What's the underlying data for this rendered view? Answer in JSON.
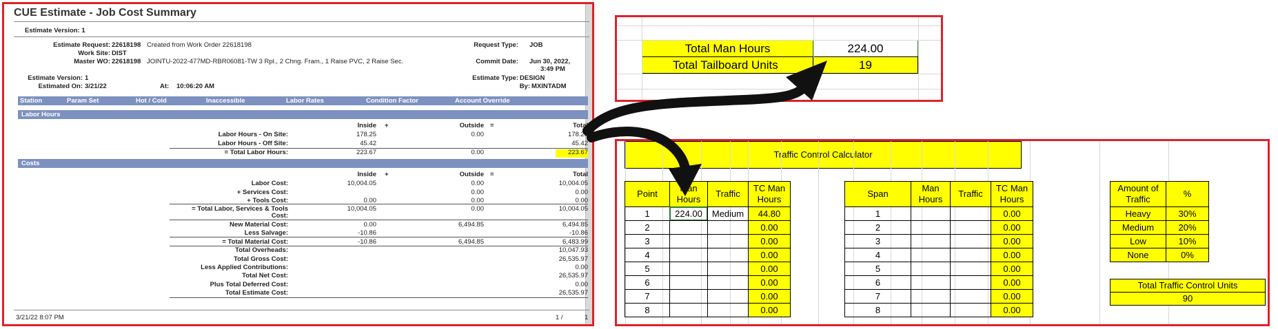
{
  "report": {
    "title": "CUE Estimate - Job Cost Summary",
    "version_line": "Estimate Version: 1",
    "estimate_request_label": "Estimate Request:",
    "estimate_request_value": "22618198",
    "created_from": "Created from Work Order 22618198",
    "request_type_label": "Request Type:",
    "request_type_value": "JOB",
    "work_site_label": "Work Site:",
    "work_site_value": "DIST",
    "master_wo_label": "Master WO:",
    "master_wo_value": "22618198",
    "master_wo_desc": "JOINTU-2022-477MD-RBR06081-TW 3 Rpl., 2 Chng. Fram., 1 Raise PVC, 2 Raise Sec.",
    "commit_date_label": "Commit Date:",
    "commit_date_value": "Jun 30, 2022,",
    "commit_time_value": "3:49 PM",
    "estimate_version_label": "Estimate Version:",
    "estimate_version_value": "1",
    "estimate_type_label": "Estimate Type:",
    "estimate_type_value": "DESIGN",
    "estimated_on_label": "Estimated On:",
    "estimated_on_value": "3/21/22",
    "at_label": "At:",
    "at_value": "10:06:20 AM",
    "by_label": "By:",
    "by_value": "MXINTADM",
    "station_columns": [
      "Station",
      "Param Set",
      "Hot / Cold",
      "Inaccessible",
      "Labor Rates",
      "Condition  Factor",
      "Account Override"
    ],
    "labor_section": "Labor Hours",
    "costs_section": "Costs",
    "col_headers": {
      "inside": "Inside",
      "plus": "+",
      "outside": "Outside",
      "eq": "=",
      "total": "Total"
    },
    "labor_rows": [
      {
        "label": "Labor Hours - On Site:",
        "inside": "178.25",
        "outside": "0.00",
        "total": "178.25"
      },
      {
        "label": "Labor Hours - Off Site:",
        "inside": "45.42",
        "outside": "",
        "total": "45.42"
      },
      {
        "label": "= Total Labor Hours:",
        "inside": "223.67",
        "outside": "0.00",
        "total": "223.67"
      }
    ],
    "cost_rows": [
      {
        "label": "Labor Cost:",
        "inside": "10,004.05",
        "outside": "0.00",
        "total": "10,004.05"
      },
      {
        "label": "+ Services Cost:",
        "inside": "",
        "outside": "0.00",
        "total": "0.00"
      },
      {
        "label": "+ Tools Cost:",
        "inside": "0.00",
        "outside": "0.00",
        "total": "0.00"
      },
      {
        "label": "= Total Labor, Services & Tools",
        "label2": "Cost:",
        "inside": "10,004.05",
        "outside": "0.00",
        "total": "10,004.05"
      },
      {
        "label": "New Material Cost:",
        "inside": "0.00",
        "outside": "6,494.85",
        "total": "6,494.85"
      },
      {
        "label": "Less Salvage:",
        "inside": "-10.86",
        "outside": "",
        "total": "-10.86"
      },
      {
        "label": "= Total Material Cost:",
        "inside": "-10.86",
        "outside": "6,494.85",
        "total": "6,483.99"
      },
      {
        "label": "Total Overheads:",
        "inside": "",
        "outside": "",
        "total": "10,047.93"
      },
      {
        "label": "Total Gross Cost:",
        "inside": "",
        "outside": "",
        "total": "26,535.97"
      },
      {
        "label": "Less Applied Contributions:",
        "inside": "",
        "outside": "",
        "total": "0.00"
      },
      {
        "label": "Total Net Cost:",
        "inside": "",
        "outside": "",
        "total": "26,535.97"
      },
      {
        "label": "Plus Total Deferred Cost:",
        "inside": "",
        "outside": "",
        "total": "0.00"
      },
      {
        "label": "Total Estimate Cost:",
        "inside": "",
        "outside": "",
        "total": "26,535.97"
      }
    ],
    "footer_datetime": "3/21/22 8:07 PM",
    "footer_page": "1 /",
    "footer_pages": "1"
  },
  "summary": {
    "total_man_hours_label": "Total Man Hours",
    "total_man_hours_value": "224.00",
    "total_tailboard_label": "Total Tailboard Units",
    "total_tailboard_value": "19"
  },
  "calculator": {
    "title": "Traffic Control Calculator",
    "point_headers": {
      "point": "Point",
      "man_hours": "Man\nHours",
      "traffic": "Traffic",
      "tc_man_hours": "TC Man\nHours"
    },
    "span_headers": {
      "span": "Span",
      "man_hours": "Man\nHours",
      "traffic": "Traffic",
      "tc_man_hours": "TC Man\nHours"
    },
    "point_rows": [
      {
        "n": "1",
        "mh": "224.00",
        "traffic": "Medium",
        "tc": "44.80"
      },
      {
        "n": "2",
        "mh": "",
        "traffic": "",
        "tc": "0.00"
      },
      {
        "n": "3",
        "mh": "",
        "traffic": "",
        "tc": "0.00"
      },
      {
        "n": "4",
        "mh": "",
        "traffic": "",
        "tc": "0.00"
      },
      {
        "n": "5",
        "mh": "",
        "traffic": "",
        "tc": "0.00"
      },
      {
        "n": "6",
        "mh": "",
        "traffic": "",
        "tc": "0.00"
      },
      {
        "n": "7",
        "mh": "",
        "traffic": "",
        "tc": "0.00"
      },
      {
        "n": "8",
        "mh": "",
        "traffic": "",
        "tc": "0.00"
      }
    ],
    "span_rows": [
      {
        "n": "1",
        "tc": "0.00"
      },
      {
        "n": "2",
        "tc": "0.00"
      },
      {
        "n": "3",
        "tc": "0.00"
      },
      {
        "n": "4",
        "tc": "0.00"
      },
      {
        "n": "5",
        "tc": "0.00"
      },
      {
        "n": "6",
        "tc": "0.00"
      },
      {
        "n": "7",
        "tc": "0.00"
      },
      {
        "n": "8",
        "tc": "0.00"
      }
    ],
    "amount_header": "Amount of\nTraffic",
    "pct_header": "%",
    "traffic_levels": [
      {
        "name": "Heavy",
        "pct": "30%"
      },
      {
        "name": "Medium",
        "pct": "20%"
      },
      {
        "name": "Low",
        "pct": "10%"
      },
      {
        "name": "None",
        "pct": "0%"
      }
    ],
    "total_units_label": "Total Traffic Control Units",
    "total_units_value": "90"
  },
  "colors": {
    "border_red": "#e0202a",
    "highlight_yellow": "#ffff00",
    "section_blue": "#7d91c0"
  }
}
